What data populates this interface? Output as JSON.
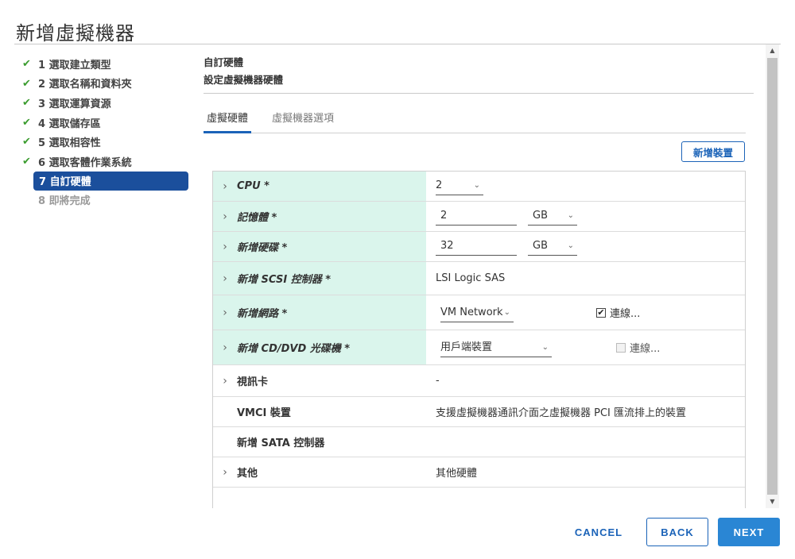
{
  "dialog": {
    "title": "新增虛擬機器"
  },
  "steps": [
    {
      "label": "1 選取建立類型",
      "state": "done"
    },
    {
      "label": "2 選取名稱和資料夾",
      "state": "done"
    },
    {
      "label": "3 選取運算資源",
      "state": "done"
    },
    {
      "label": "4 選取儲存區",
      "state": "done"
    },
    {
      "label": "5 選取相容性",
      "state": "done"
    },
    {
      "label": "6 選取客體作業系統",
      "state": "done"
    },
    {
      "label": "7 自訂硬體",
      "state": "current"
    },
    {
      "label": "8 即將完成",
      "state": "pending"
    }
  ],
  "check_glyph": "✔",
  "content": {
    "heading": "自訂硬體",
    "subheading": "設定虛擬機器硬體"
  },
  "tabs": [
    {
      "label": "虛擬硬體",
      "active": true
    },
    {
      "label": "虛擬機器選項",
      "active": false
    }
  ],
  "add_device_button": "新增裝置",
  "hardware": {
    "cpu": {
      "label": "CPU *",
      "value": "2"
    },
    "memory": {
      "label": "記憶體 *",
      "value": "2",
      "unit": "GB"
    },
    "new_disk": {
      "label": "新增硬碟 *",
      "value": "32",
      "unit": "GB"
    },
    "scsi": {
      "label": "新增 SCSI 控制器 *",
      "value": "LSI Logic SAS"
    },
    "network": {
      "label": "新增網路 *",
      "value": "VM Network",
      "connect_label": "連線...",
      "connected": true
    },
    "cd_dvd": {
      "label": "新增 CD/DVD 光碟機 *",
      "value": "用戶端裝置",
      "connect_label": "連線...",
      "connected": false
    },
    "video": {
      "label": "視訊卡",
      "value": "-"
    },
    "vmci": {
      "label": "VMCI 裝置",
      "value": "支援虛擬機器通訊介面之虛擬機器 PCI 匯流排上的裝置"
    },
    "sata": {
      "label": "新增 SATA 控制器",
      "value": ""
    },
    "other": {
      "label": "其他",
      "value": "其他硬體"
    }
  },
  "glyphs": {
    "chevron_right": "›",
    "caret_down": "⌄",
    "check_mark": "✔",
    "scroll_up": "▲",
    "scroll_down": "▼"
  },
  "footer": {
    "cancel": "CANCEL",
    "back": "BACK",
    "next": "NEXT"
  },
  "colors": {
    "accent": "#1b63b8",
    "current_step": "#1b4f9c",
    "check_green": "#3b9c2f",
    "required_row_bg": "#daf5ec",
    "next_button": "#2a86d4"
  }
}
